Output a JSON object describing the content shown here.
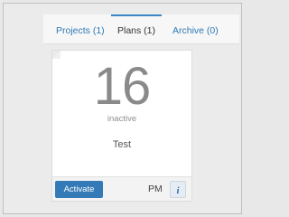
{
  "tabs": {
    "projects": "Projects (1)",
    "plans": "Plans (1)",
    "archive": "Archive (0)"
  },
  "card": {
    "count": "16",
    "status": "inactive",
    "name": "Test",
    "activate_label": "Activate",
    "owner": "PM",
    "info_icon": "i"
  },
  "colors": {
    "accent": "#337ab7",
    "link": "#2f79b5",
    "number": "#8a8a8a"
  }
}
